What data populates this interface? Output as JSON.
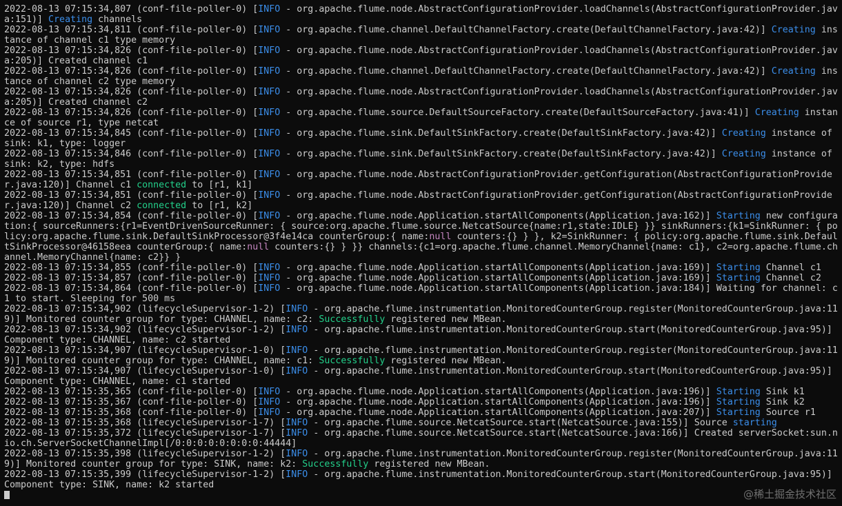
{
  "colors": {
    "background": "#0c0c0c",
    "text": "#cccccc",
    "info_highlight": "#3b8eea",
    "success_highlight": "#23d18b",
    "null_highlight": "#c586c0"
  },
  "log_lines": [
    [
      [
        "2022-08-13 07:15:34,807 (conf-file-poller-0) [",
        ""
      ],
      [
        "INFO",
        "hl"
      ],
      [
        " - org.apache.flume.node.AbstractConfigurationProvider.loadChannels(AbstractConfigurationProvider.java:151)] ",
        ""
      ],
      [
        "Creating",
        "hl"
      ],
      [
        " channels",
        ""
      ]
    ],
    [
      [
        "2022-08-13 07:15:34,811 (conf-file-poller-0) [",
        ""
      ],
      [
        "INFO",
        "hl"
      ],
      [
        " - org.apache.flume.channel.DefaultChannelFactory.create(DefaultChannelFactory.java:42)] ",
        ""
      ],
      [
        "Creating",
        "hl"
      ],
      [
        " instance of channel c1 type memory",
        ""
      ]
    ],
    [
      [
        "2022-08-13 07:15:34,826 (conf-file-poller-0) [",
        ""
      ],
      [
        "INFO",
        "hl"
      ],
      [
        " - org.apache.flume.node.AbstractConfigurationProvider.loadChannels(AbstractConfigurationProvider.java:205)] Created channel c1",
        ""
      ]
    ],
    [
      [
        "2022-08-13 07:15:34,826 (conf-file-poller-0) [",
        ""
      ],
      [
        "INFO",
        "hl"
      ],
      [
        " - org.apache.flume.channel.DefaultChannelFactory.create(DefaultChannelFactory.java:42)] ",
        ""
      ],
      [
        "Creating",
        "hl"
      ],
      [
        " instance of channel c2 type memory",
        ""
      ]
    ],
    [
      [
        "2022-08-13 07:15:34,826 (conf-file-poller-0) [",
        ""
      ],
      [
        "INFO",
        "hl"
      ],
      [
        " - org.apache.flume.node.AbstractConfigurationProvider.loadChannels(AbstractConfigurationProvider.java:205)] Created channel c2",
        ""
      ]
    ],
    [
      [
        "2022-08-13 07:15:34,826 (conf-file-poller-0) [",
        ""
      ],
      [
        "INFO",
        "hl"
      ],
      [
        " - org.apache.flume.source.DefaultSourceFactory.create(DefaultSourceFactory.java:41)] ",
        ""
      ],
      [
        "Creating",
        "hl"
      ],
      [
        " instance of source r1, type netcat",
        ""
      ]
    ],
    [
      [
        "2022-08-13 07:15:34,845 (conf-file-poller-0) [",
        ""
      ],
      [
        "INFO",
        "hl"
      ],
      [
        " - org.apache.flume.sink.DefaultSinkFactory.create(DefaultSinkFactory.java:42)] ",
        ""
      ],
      [
        "Creating",
        "hl"
      ],
      [
        " instance of sink: k1, type: logger",
        ""
      ]
    ],
    [
      [
        "2022-08-13 07:15:34,846 (conf-file-poller-0) [",
        ""
      ],
      [
        "INFO",
        "hl"
      ],
      [
        " - org.apache.flume.sink.DefaultSinkFactory.create(DefaultSinkFactory.java:42)] ",
        ""
      ],
      [
        "Creating",
        "hl"
      ],
      [
        " instance of sink: k2, type: hdfs",
        ""
      ]
    ],
    [
      [
        "2022-08-13 07:15:34,851 (conf-file-poller-0) [",
        ""
      ],
      [
        "INFO",
        "hl"
      ],
      [
        " - org.apache.flume.node.AbstractConfigurationProvider.getConfiguration(AbstractConfigurationProvider.java:120)] Channel c1 ",
        ""
      ],
      [
        "connected",
        "green"
      ],
      [
        " to [r1, k1]",
        ""
      ]
    ],
    [
      [
        "2022-08-13 07:15:34,851 (conf-file-poller-0) [",
        ""
      ],
      [
        "INFO",
        "hl"
      ],
      [
        " - org.apache.flume.node.AbstractConfigurationProvider.getConfiguration(AbstractConfigurationProvider.java:120)] Channel c2 ",
        ""
      ],
      [
        "connected",
        "green"
      ],
      [
        " to [r1, k2]",
        ""
      ]
    ],
    [
      [
        "2022-08-13 07:15:34,854 (conf-file-poller-0) [",
        ""
      ],
      [
        "INFO",
        "hl"
      ],
      [
        " - org.apache.flume.node.Application.startAllComponents(Application.java:162)] ",
        ""
      ],
      [
        "Starting",
        "hl"
      ],
      [
        " new configuration:{ sourceRunners:{r1=EventDrivenSourceRunner: { source:org.apache.flume.source.NetcatSource{name:r1,state:IDLE} }} sinkRunners:{k1=SinkRunner: { policy:org.apache.flume.sink.DefaultSinkProcessor@3f4e14ca counterGroup:{ name:",
        ""
      ],
      [
        "null",
        "null"
      ],
      [
        " counters:{} } }, k2=SinkRunner: { policy:org.apache.flume.sink.DefaultSinkProcessor@46158eea counterGroup:{ name:",
        ""
      ],
      [
        "null",
        "null"
      ],
      [
        " counters:{} } }} channels:{c1=org.apache.flume.channel.MemoryChannel{name: c1}, c2=org.apache.flume.channel.MemoryChannel{name: c2}} }",
        ""
      ]
    ],
    [
      [
        "2022-08-13 07:15:34,855 (conf-file-poller-0) [",
        ""
      ],
      [
        "INFO",
        "hl"
      ],
      [
        " - org.apache.flume.node.Application.startAllComponents(Application.java:169)] ",
        ""
      ],
      [
        "Starting",
        "hl"
      ],
      [
        " Channel c1",
        ""
      ]
    ],
    [
      [
        "2022-08-13 07:15:34,857 (conf-file-poller-0) [",
        ""
      ],
      [
        "INFO",
        "hl"
      ],
      [
        " - org.apache.flume.node.Application.startAllComponents(Application.java:169)] ",
        ""
      ],
      [
        "Starting",
        "hl"
      ],
      [
        " Channel c2",
        ""
      ]
    ],
    [
      [
        "2022-08-13 07:15:34,864 (conf-file-poller-0) [",
        ""
      ],
      [
        "INFO",
        "hl"
      ],
      [
        " - org.apache.flume.node.Application.startAllComponents(Application.java:184)] Waiting for channel: c1 to start. Sleeping for 500 ms",
        ""
      ]
    ],
    [
      [
        "2022-08-13 07:15:34,902 (lifecycleSupervisor-1-2) [",
        ""
      ],
      [
        "INFO",
        "hl"
      ],
      [
        " - org.apache.flume.instrumentation.MonitoredCounterGroup.register(MonitoredCounterGroup.java:119)] Monitored counter group for type: CHANNEL, name: c2: ",
        ""
      ],
      [
        "Successfully",
        "green"
      ],
      [
        " registered new MBean.",
        ""
      ]
    ],
    [
      [
        "2022-08-13 07:15:34,902 (lifecycleSupervisor-1-2) [",
        ""
      ],
      [
        "INFO",
        "hl"
      ],
      [
        " - org.apache.flume.instrumentation.MonitoredCounterGroup.start(MonitoredCounterGroup.java:95)] Component type: CHANNEL, name: c2 started",
        ""
      ]
    ],
    [
      [
        "2022-08-13 07:15:34,907 (lifecycleSupervisor-1-0) [",
        ""
      ],
      [
        "INFO",
        "hl"
      ],
      [
        " - org.apache.flume.instrumentation.MonitoredCounterGroup.register(MonitoredCounterGroup.java:119)] Monitored counter group for type: CHANNEL, name: c1: ",
        ""
      ],
      [
        "Successfully",
        "green"
      ],
      [
        " registered new MBean.",
        ""
      ]
    ],
    [
      [
        "2022-08-13 07:15:34,907 (lifecycleSupervisor-1-0) [",
        ""
      ],
      [
        "INFO",
        "hl"
      ],
      [
        " - org.apache.flume.instrumentation.MonitoredCounterGroup.start(MonitoredCounterGroup.java:95)] Component type: CHANNEL, name: c1 started",
        ""
      ]
    ],
    [
      [
        "2022-08-13 07:15:35,365 (conf-file-poller-0) [",
        ""
      ],
      [
        "INFO",
        "hl"
      ],
      [
        " - org.apache.flume.node.Application.startAllComponents(Application.java:196)] ",
        ""
      ],
      [
        "Starting",
        "hl"
      ],
      [
        " Sink k1",
        ""
      ]
    ],
    [
      [
        "2022-08-13 07:15:35,367 (conf-file-poller-0) [",
        ""
      ],
      [
        "INFO",
        "hl"
      ],
      [
        " - org.apache.flume.node.Application.startAllComponents(Application.java:196)] ",
        ""
      ],
      [
        "Starting",
        "hl"
      ],
      [
        " Sink k2",
        ""
      ]
    ],
    [
      [
        "2022-08-13 07:15:35,368 (conf-file-poller-0) [",
        ""
      ],
      [
        "INFO",
        "hl"
      ],
      [
        " - org.apache.flume.node.Application.startAllComponents(Application.java:207)] ",
        ""
      ],
      [
        "Starting",
        "hl"
      ],
      [
        " Source r1",
        ""
      ]
    ],
    [
      [
        "2022-08-13 07:15:35,368 (lifecycleSupervisor-1-7) [",
        ""
      ],
      [
        "INFO",
        "hl"
      ],
      [
        " - org.apache.flume.source.NetcatSource.start(NetcatSource.java:155)] Source ",
        ""
      ],
      [
        "starting",
        "hl"
      ]
    ],
    [
      [
        "2022-08-13 07:15:35,372 (lifecycleSupervisor-1-7) [",
        ""
      ],
      [
        "INFO",
        "hl"
      ],
      [
        " - org.apache.flume.source.NetcatSource.start(NetcatSource.java:166)] Created serverSocket:sun.nio.ch.ServerSocketChannelImpl[/0:0:0:0:0:0:0:0:44444]",
        ""
      ]
    ],
    [
      [
        "2022-08-13 07:15:35,398 (lifecycleSupervisor-1-2) [",
        ""
      ],
      [
        "INFO",
        "hl"
      ],
      [
        " - org.apache.flume.instrumentation.MonitoredCounterGroup.register(MonitoredCounterGroup.java:119)] Monitored counter group for type: SINK, name: k2: ",
        ""
      ],
      [
        "Successfully",
        "green"
      ],
      [
        " registered new MBean.",
        ""
      ]
    ],
    [
      [
        "2022-08-13 07:15:35,399 (lifecycleSupervisor-1-2) [",
        ""
      ],
      [
        "INFO",
        "hl"
      ],
      [
        " - org.apache.flume.instrumentation.MonitoredCounterGroup.start(MonitoredCounterGroup.java:95)] Component type: SINK, name: k2 started",
        ""
      ]
    ]
  ],
  "cursor": "block-cursor",
  "watermark": "@稀土掘金技术社区"
}
